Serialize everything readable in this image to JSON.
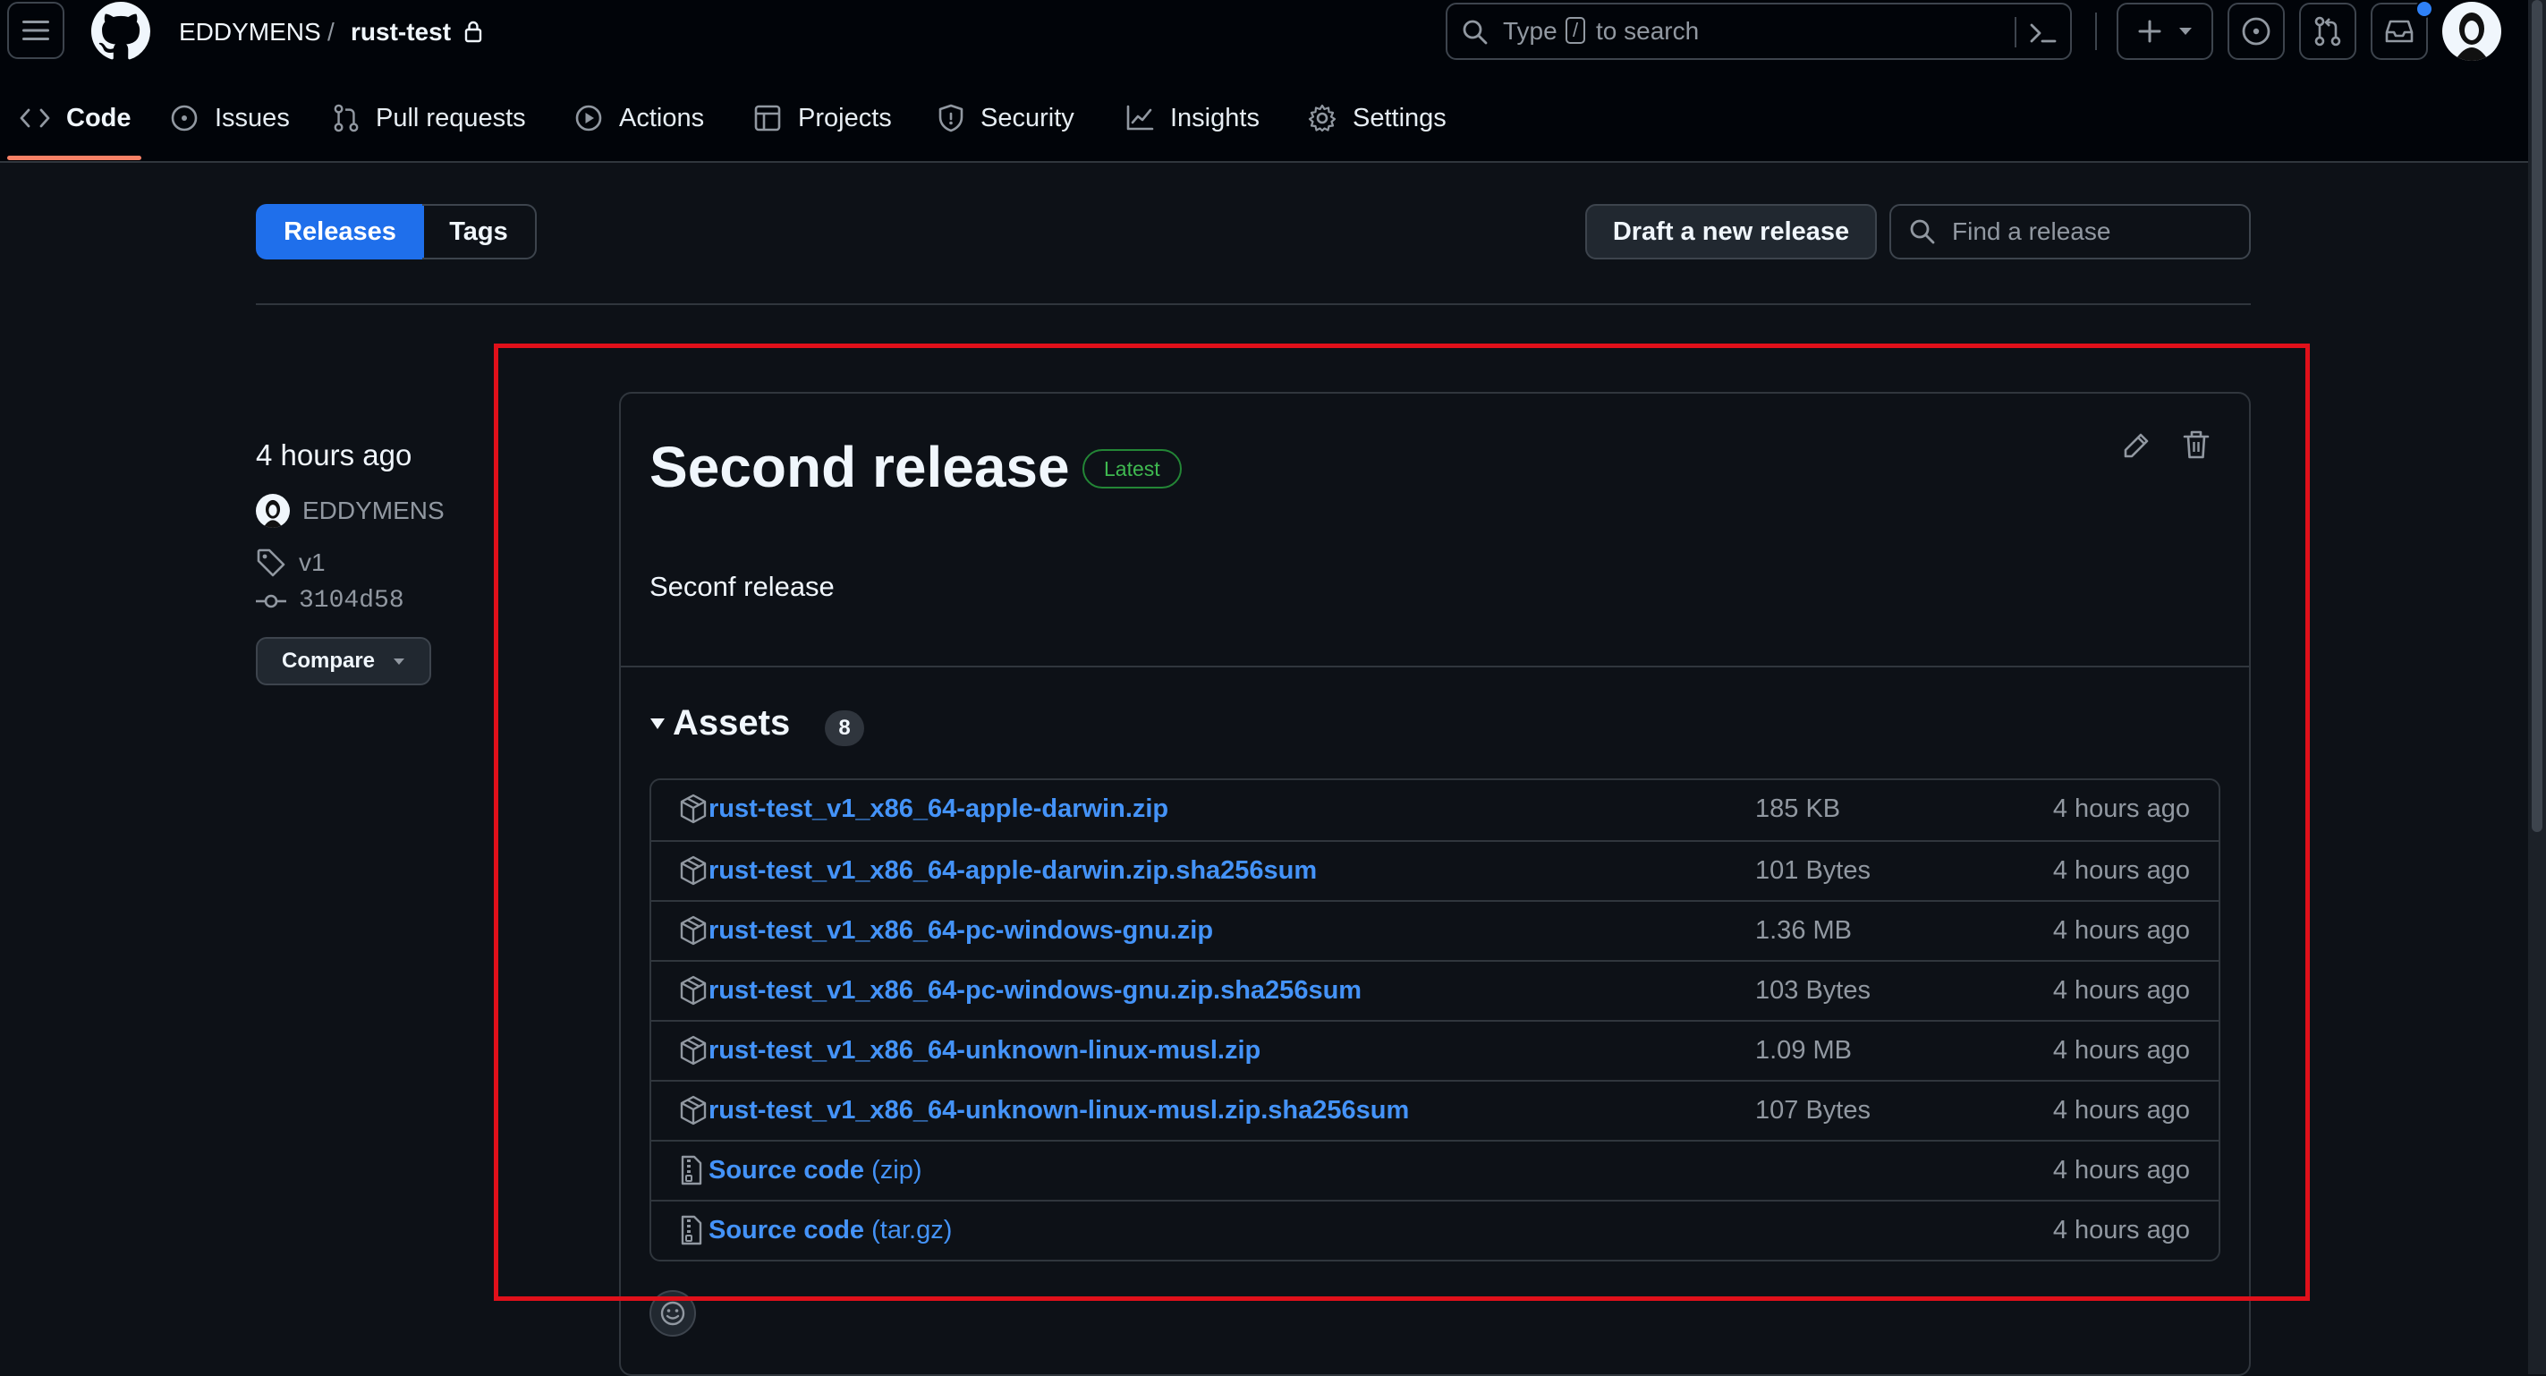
{
  "header": {
    "owner": "EDDYMENS",
    "separator": "/",
    "repo": "rust-test",
    "search": {
      "prefix": "Type",
      "key": "/",
      "suffix": "to search"
    },
    "notification_color": "#2f81f7"
  },
  "repo_nav": [
    {
      "label": "Code",
      "icon": "code-icon",
      "active": true
    },
    {
      "label": "Issues",
      "icon": "issue-opened-icon"
    },
    {
      "label": "Pull requests",
      "icon": "git-pull-request-icon"
    },
    {
      "label": "Actions",
      "icon": "play-icon"
    },
    {
      "label": "Projects",
      "icon": "table-icon"
    },
    {
      "label": "Security",
      "icon": "shield-icon"
    },
    {
      "label": "Insights",
      "icon": "graph-icon"
    },
    {
      "label": "Settings",
      "icon": "gear-icon"
    }
  ],
  "subnav": {
    "releases": "Releases",
    "tags": "Tags",
    "draft_button": "Draft a new release",
    "find_placeholder": "Find a release",
    "accent": "#1f6feb"
  },
  "release_meta": {
    "time": "4 hours ago",
    "author": "EDDYMENS",
    "tag": "v1",
    "commit": "3104d58",
    "compare": "Compare"
  },
  "release": {
    "title": "Second release",
    "badge": "Latest",
    "badge_color": "#3fb950",
    "body": "Seconf release",
    "assets_label": "Assets",
    "assets_count": "8",
    "assets": [
      {
        "name": "rust-test_v1_x86_64-apple-darwin.zip",
        "ext": "",
        "size": "185 KB",
        "time": "4 hours ago",
        "icon": "package-icon"
      },
      {
        "name": "rust-test_v1_x86_64-apple-darwin.zip.sha256sum",
        "ext": "",
        "size": "101 Bytes",
        "time": "4 hours ago",
        "icon": "package-icon"
      },
      {
        "name": "rust-test_v1_x86_64-pc-windows-gnu.zip",
        "ext": "",
        "size": "1.36 MB",
        "time": "4 hours ago",
        "icon": "package-icon"
      },
      {
        "name": "rust-test_v1_x86_64-pc-windows-gnu.zip.sha256sum",
        "ext": "",
        "size": "103 Bytes",
        "time": "4 hours ago",
        "icon": "package-icon"
      },
      {
        "name": "rust-test_v1_x86_64-unknown-linux-musl.zip",
        "ext": "",
        "size": "1.09 MB",
        "time": "4 hours ago",
        "icon": "package-icon"
      },
      {
        "name": "rust-test_v1_x86_64-unknown-linux-musl.zip.sha256sum",
        "ext": "",
        "size": "107 Bytes",
        "time": "4 hours ago",
        "icon": "package-icon"
      },
      {
        "name": "Source code",
        "ext": "(zip)",
        "size": "",
        "time": "4 hours ago",
        "icon": "file-zip-icon"
      },
      {
        "name": "Source code",
        "ext": "(tar.gz)",
        "size": "",
        "time": "4 hours ago",
        "icon": "file-zip-icon"
      }
    ]
  },
  "highlight_color": "#e0101a"
}
